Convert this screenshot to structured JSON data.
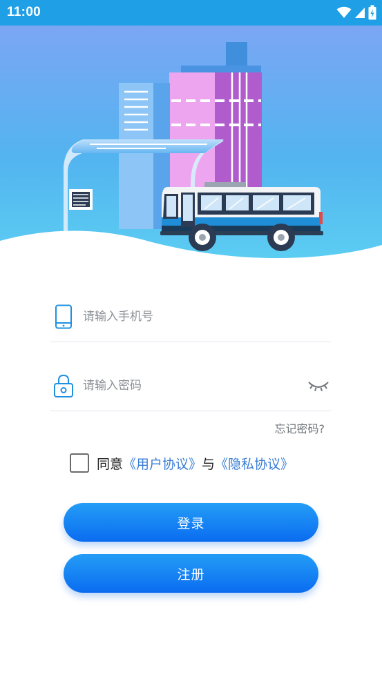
{
  "status_bar": {
    "time": "11:00",
    "icons": [
      "wifi-icon",
      "signal-icon",
      "battery-icon"
    ]
  },
  "hero": {
    "illustration": "city-bus-stop-illustration",
    "colors": {
      "sky_top": "#7ba6f4",
      "sky_bottom": "#57c9f1",
      "tower_pink": "#eca5ee",
      "tower_purple": "#b05ccd",
      "bus_body": "#f2f4f6",
      "bus_stripe": "#1f8ed6"
    }
  },
  "login_form": {
    "phone": {
      "icon": "phone-icon",
      "placeholder": "请输入手机号",
      "value": ""
    },
    "password": {
      "icon": "lock-icon",
      "placeholder": "请输入密码",
      "value": "",
      "toggle_icon": "eye-closed-icon"
    },
    "forgot_password": "忘记密码?",
    "agreement": {
      "checked": false,
      "prefix": "同意",
      "user_agreement": "《用户协议》",
      "connector": "与",
      "privacy_agreement": "《隐私协议》"
    },
    "login_label": "登录",
    "register_label": "注册"
  },
  "theme": {
    "primary": "#0a6cf0",
    "primary_light": "#249df6",
    "link": "#3b7fd6",
    "icon": "#1e90e0"
  }
}
